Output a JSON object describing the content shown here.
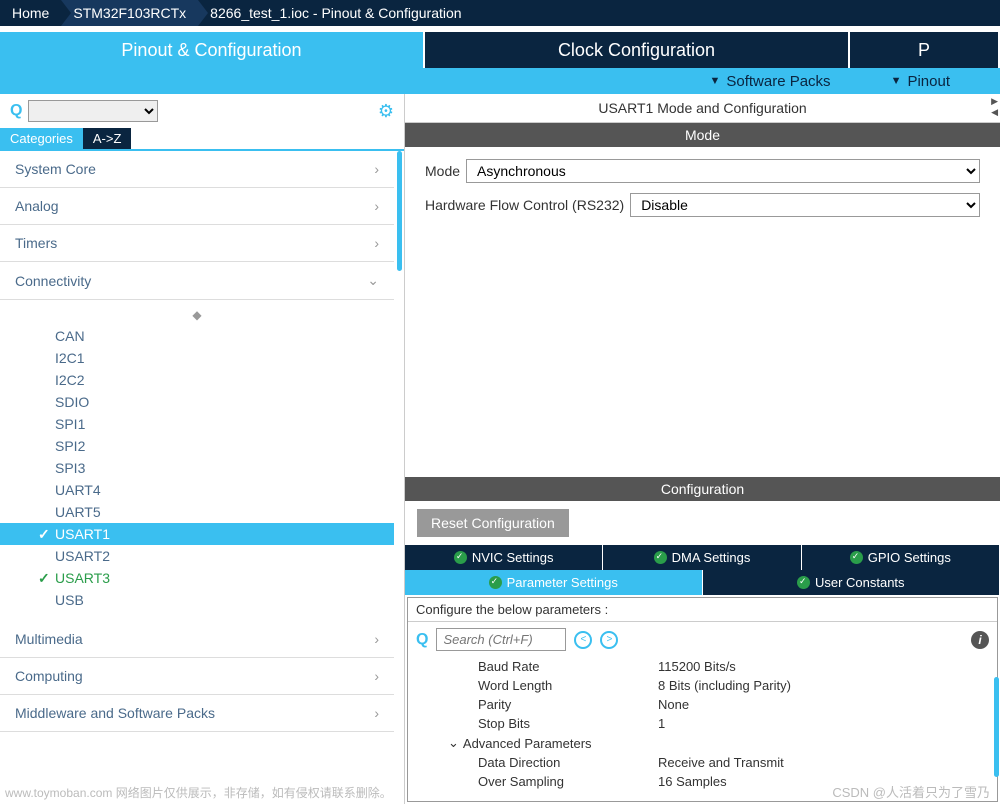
{
  "breadcrumb": [
    "Home",
    "STM32F103RCTx",
    "8266_test_1.ioc - Pinout & Configuration"
  ],
  "mainTabs": {
    "active": "Pinout & Configuration",
    "others": [
      "Clock Configuration",
      "P"
    ]
  },
  "subBar": [
    "Software Packs",
    "Pinout"
  ],
  "leftPanel": {
    "filterTabs": {
      "active": "Categories",
      "other": "A->Z"
    },
    "groups": [
      {
        "name": "System Core",
        "expanded": false
      },
      {
        "name": "Analog",
        "expanded": false
      },
      {
        "name": "Timers",
        "expanded": false
      },
      {
        "name": "Connectivity",
        "expanded": true,
        "items": [
          {
            "label": "CAN"
          },
          {
            "label": "I2C1"
          },
          {
            "label": "I2C2"
          },
          {
            "label": "SDIO"
          },
          {
            "label": "SPI1"
          },
          {
            "label": "SPI2"
          },
          {
            "label": "SPI3"
          },
          {
            "label": "UART4"
          },
          {
            "label": "UART5"
          },
          {
            "label": "USART1",
            "checked": true,
            "selected": true
          },
          {
            "label": "USART2"
          },
          {
            "label": "USART3",
            "checked": true,
            "green": true
          },
          {
            "label": "USB"
          }
        ]
      },
      {
        "name": "Multimedia",
        "expanded": false
      },
      {
        "name": "Computing",
        "expanded": false
      },
      {
        "name": "Middleware and Software Packs",
        "expanded": false
      }
    ]
  },
  "rightPanel": {
    "title": "USART1 Mode and Configuration",
    "modeHeader": "Mode",
    "modeRows": [
      {
        "label": "Mode",
        "value": "Asynchronous"
      },
      {
        "label": "Hardware Flow Control (RS232)",
        "value": "Disable"
      }
    ],
    "configHeader": "Configuration",
    "resetBtn": "Reset Configuration",
    "settingTabsTop": [
      "NVIC Settings",
      "DMA Settings",
      "GPIO Settings"
    ],
    "settingTabsBottom": {
      "active": "Parameter Settings",
      "other": "User Constants"
    },
    "paramHeader": "Configure the below parameters :",
    "searchPlaceholder": "Search (Ctrl+F)",
    "params": [
      {
        "key": "Baud Rate",
        "val": "115200 Bits/s"
      },
      {
        "key": "Word Length",
        "val": "8 Bits (including Parity)"
      },
      {
        "key": "Parity",
        "val": "None"
      },
      {
        "key": "Stop Bits",
        "val": "1"
      }
    ],
    "advGroup": "Advanced Parameters",
    "advParams": [
      {
        "key": "Data Direction",
        "val": "Receive and Transmit"
      },
      {
        "key": "Over Sampling",
        "val": "16 Samples"
      }
    ]
  },
  "watermark": "CSDN @人活着只为了雪乃",
  "watermarkLeft": "www.toymoban.com 网络图片仅供展示，非存储，如有侵权请联系删除。"
}
